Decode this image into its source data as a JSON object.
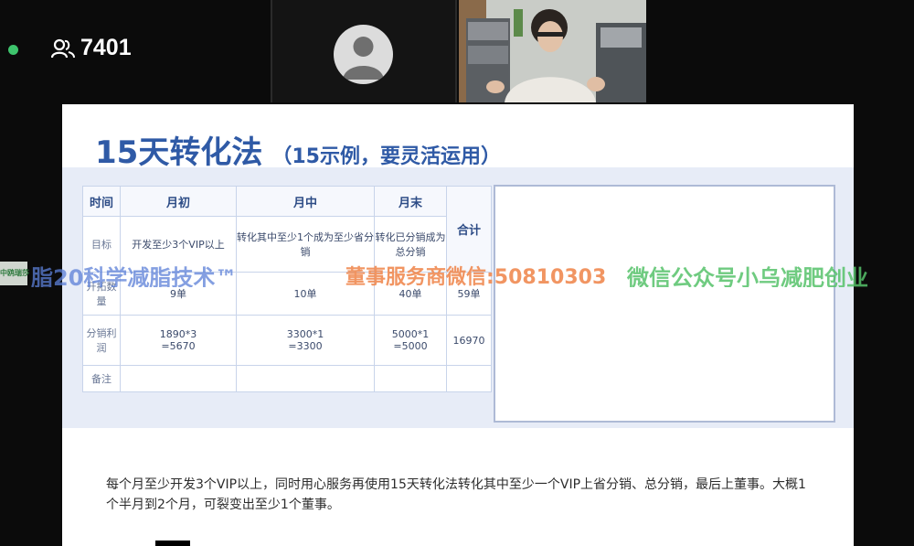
{
  "meeting": {
    "participant_count": "7401",
    "status_color": "#3ec46d"
  },
  "tiles": {
    "avatar_icon": "person-icon",
    "video_icon": "presenter-video"
  },
  "slide": {
    "title_main": "15天转化法",
    "title_sub": "（15示例，要灵活运用）",
    "table": {
      "headers": [
        "时间",
        "月初",
        "月中",
        "月末"
      ],
      "total_header": "合计",
      "rows": [
        {
          "label": "目标",
          "cells": [
            "开发至少3个VIP以上",
            "转化其中至少1个成为至少省分销",
            "转化已分销成为总分销"
          ]
        },
        {
          "label": "开拓数量",
          "cells": [
            "9单",
            "10单",
            "40单"
          ],
          "total": "59单"
        },
        {
          "label": "分销利润",
          "cells": [
            "1890*3\n=5670",
            "3300*1\n=3300",
            "5000*1\n=5000"
          ],
          "total": "16970"
        },
        {
          "label": "备注",
          "cells": [
            "",
            "",
            ""
          ]
        }
      ]
    },
    "note": "每个月至少开发3个VIP以上，同时用心服务再使用15天转化法转化其中至少一个VIP上省分销、总分销，最后上董事。大概1个半月到2个月，可裂变出至少1个董事。"
  },
  "watermark": {
    "logo": "中鸥瑞莎",
    "part1": "脂20科学减脂技术™",
    "part2": "董事服务商微信:50810303",
    "part3": "微信公众号小乌减肥创业"
  }
}
